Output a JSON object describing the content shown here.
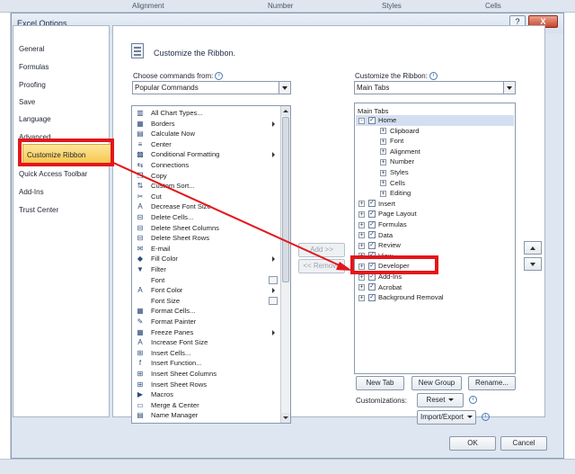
{
  "background": {
    "headers": [
      "Alignment",
      "Number",
      "Styles",
      "Cells"
    ]
  },
  "window": {
    "title": "Excel Options",
    "help": "?",
    "close": "X"
  },
  "nav": {
    "items": [
      "General",
      "Formulas",
      "Proofing",
      "Save",
      "Language",
      "Advanced",
      "Customize Ribbon",
      "Quick Access Toolbar",
      "Add-Ins",
      "Trust Center"
    ],
    "selected": "Customize Ribbon"
  },
  "main": {
    "heading": "Customize the Ribbon."
  },
  "left_panel": {
    "choose_label": "Choose commands from:",
    "choose_value": "Popular Commands",
    "commands": [
      {
        "label": "All Chart Types...",
        "icon": "chart-icon"
      },
      {
        "label": "Borders",
        "icon": "borders-icon",
        "submenu": true
      },
      {
        "label": "Calculate Now",
        "icon": "calculate-icon"
      },
      {
        "label": "Center",
        "icon": "center-icon"
      },
      {
        "label": "Conditional Formatting",
        "icon": "conditional-formatting-icon",
        "submenu": true
      },
      {
        "label": "Connections",
        "icon": "connections-icon"
      },
      {
        "label": "Copy",
        "icon": "copy-icon"
      },
      {
        "label": "Custom Sort...",
        "icon": "sort-icon"
      },
      {
        "label": "Cut",
        "icon": "cut-icon"
      },
      {
        "label": "Decrease Font Size",
        "icon": "decrease-font-icon"
      },
      {
        "label": "Delete Cells...",
        "icon": "delete-cells-icon"
      },
      {
        "label": "Delete Sheet Columns",
        "icon": "delete-columns-icon"
      },
      {
        "label": "Delete Sheet Rows",
        "icon": "delete-rows-icon"
      },
      {
        "label": "E-mail",
        "icon": "email-icon"
      },
      {
        "label": "Fill Color",
        "icon": "fill-color-icon",
        "submenu": true
      },
      {
        "label": "Filter",
        "icon": "filter-icon"
      },
      {
        "label": "Font",
        "icon": "font-icon",
        "picker": true
      },
      {
        "label": "Font Color",
        "icon": "font-color-icon",
        "submenu": true
      },
      {
        "label": "Font Size",
        "icon": "font-size-icon",
        "picker": true
      },
      {
        "label": "Format Cells...",
        "icon": "format-cells-icon"
      },
      {
        "label": "Format Painter",
        "icon": "format-painter-icon"
      },
      {
        "label": "Freeze Panes",
        "icon": "freeze-panes-icon",
        "submenu": true
      },
      {
        "label": "Increase Font Size",
        "icon": "increase-font-icon"
      },
      {
        "label": "Insert Cells...",
        "icon": "insert-cells-icon"
      },
      {
        "label": "Insert Function...",
        "icon": "insert-function-icon"
      },
      {
        "label": "Insert Sheet Columns",
        "icon": "insert-columns-icon"
      },
      {
        "label": "Insert Sheet Rows",
        "icon": "insert-rows-icon"
      },
      {
        "label": "Macros",
        "icon": "macros-icon"
      },
      {
        "label": "Merge & Center",
        "icon": "merge-center-icon"
      },
      {
        "label": "Name Manager",
        "icon": "name-manager-icon"
      }
    ]
  },
  "middle": {
    "add": "Add >>",
    "remove": "<< Remove"
  },
  "right_panel": {
    "customize_label": "Customize the Ribbon:",
    "customize_value": "Main Tabs",
    "tree_header": "Main Tabs",
    "tree": [
      {
        "label": "Home",
        "level": 0,
        "expander": "-",
        "checked": true
      },
      {
        "label": "Clipboard",
        "level": 1,
        "expander": "+"
      },
      {
        "label": "Font",
        "level": 1,
        "expander": "+"
      },
      {
        "label": "Alignment",
        "level": 1,
        "expander": "+"
      },
      {
        "label": "Number",
        "level": 1,
        "expander": "+"
      },
      {
        "label": "Styles",
        "level": 1,
        "expander": "+"
      },
      {
        "label": "Cells",
        "level": 1,
        "expander": "+"
      },
      {
        "label": "Editing",
        "level": 1,
        "expander": "+"
      },
      {
        "label": "Insert",
        "level": 0,
        "expander": "+",
        "checked": true
      },
      {
        "label": "Page Layout",
        "level": 0,
        "expander": "+",
        "checked": true
      },
      {
        "label": "Formulas",
        "level": 0,
        "expander": "+",
        "checked": true
      },
      {
        "label": "Data",
        "level": 0,
        "expander": "+",
        "checked": true
      },
      {
        "label": "Review",
        "level": 0,
        "expander": "+",
        "checked": true
      },
      {
        "label": "View",
        "level": 0,
        "expander": "+",
        "checked": true
      },
      {
        "label": "Developer",
        "level": 0,
        "expander": "+",
        "checked": true
      },
      {
        "label": "Add-Ins",
        "level": 0,
        "expander": "+",
        "checked": true
      },
      {
        "label": "Acrobat",
        "level": 0,
        "expander": "+",
        "checked": true
      },
      {
        "label": "Background Removal",
        "level": 0,
        "expander": "+",
        "checked": true
      }
    ],
    "new_tab": "New Tab",
    "new_group": "New Group",
    "rename": "Rename...",
    "customizations_label": "Customizations:",
    "reset": "Reset",
    "import_export": "Import/Export"
  },
  "footer": {
    "ok": "OK",
    "cancel": "Cancel"
  },
  "colors": {
    "highlight": "#e3161b",
    "selected_nav": "#f8c64a"
  }
}
